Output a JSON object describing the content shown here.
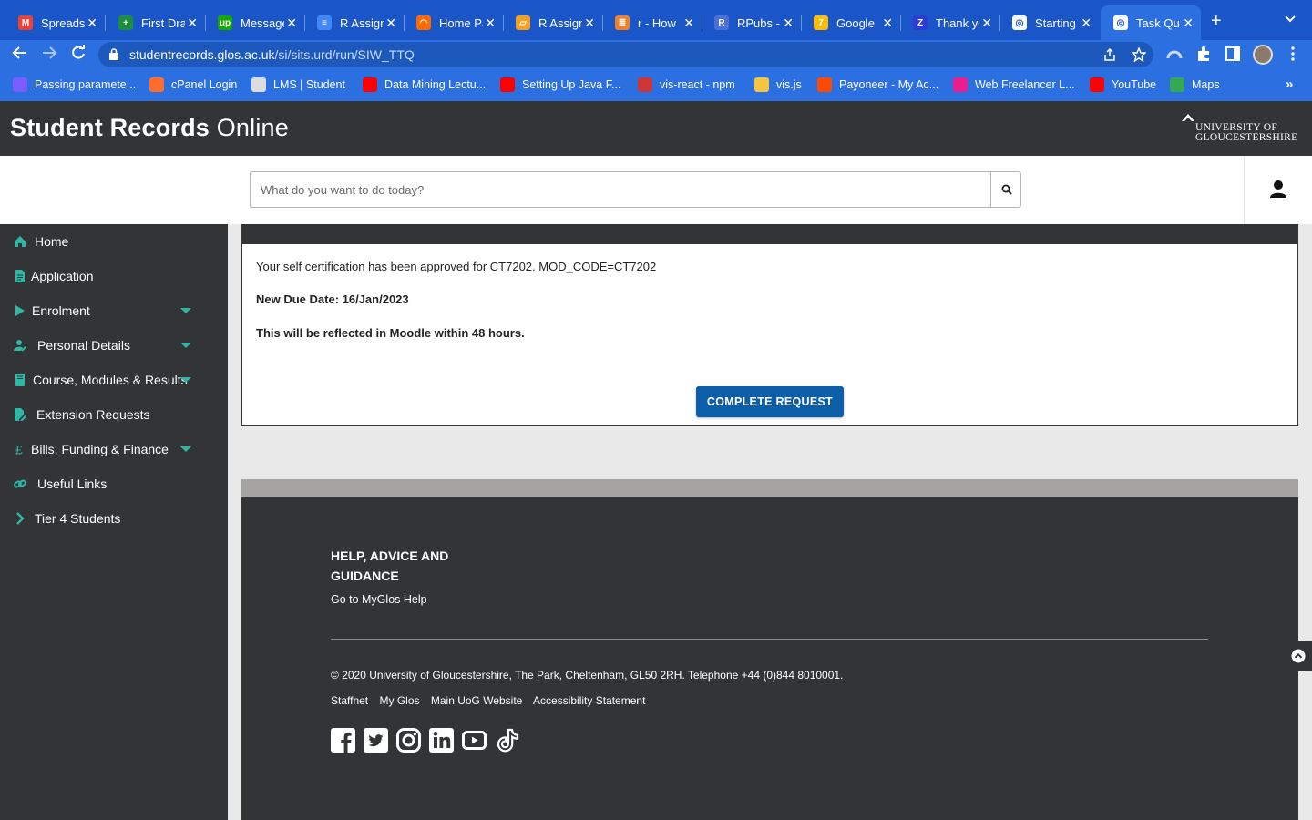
{
  "browser": {
    "tabs": [
      {
        "title": "Spreadsheet",
        "favicon_color": "#ea4335",
        "favicon_glyph": "M"
      },
      {
        "title": "First Draft",
        "favicon_color": "#1e8e3e",
        "favicon_glyph": "+"
      },
      {
        "title": "Messages",
        "favicon_color": "#14a800",
        "favicon_glyph": "up"
      },
      {
        "title": "R Assignment",
        "favicon_color": "#4285f4",
        "favicon_glyph": "≡"
      },
      {
        "title": "Home Page",
        "favicon_color": "#ff6a00",
        "favicon_glyph": "◠"
      },
      {
        "title": "R Assignment",
        "favicon_color": "#f4a020",
        "favicon_glyph": "▱"
      },
      {
        "title": "r - How",
        "favicon_color": "#f48024",
        "favicon_glyph": "≣"
      },
      {
        "title": "RPubs -",
        "favicon_color": "#4a6fd6",
        "favicon_glyph": "R"
      },
      {
        "title": "Google",
        "favicon_color": "#fbbc04",
        "favicon_glyph": "7"
      },
      {
        "title": "Thank you",
        "favicon_color": "#2d3bd7",
        "favicon_glyph": "Z"
      },
      {
        "title": "Starting",
        "favicon_color": "#ffffff",
        "favicon_glyph": "◎"
      },
      {
        "title": "Task Queue",
        "favicon_color": "#ffffff",
        "favicon_glyph": "◎"
      }
    ],
    "url_host": "studentrecords.glos.ac.uk",
    "url_path": "/si/sits.urd/run/SIW_TTQ",
    "bookmarks": [
      {
        "label": "Passing paramete...",
        "color": "#7b5cff"
      },
      {
        "label": "cPanel Login",
        "color": "#ff6c2c"
      },
      {
        "label": "LMS | Student",
        "color": "#dddddd"
      },
      {
        "label": "Data Mining Lectu...",
        "color": "#ff0000"
      },
      {
        "label": "Setting Up Java F...",
        "color": "#ff0000"
      },
      {
        "label": "vis-react - npm",
        "color": "#cb3837"
      },
      {
        "label": "vis.js",
        "color": "#f5c542"
      },
      {
        "label": "Payoneer - My Ac...",
        "color": "#ff4800"
      },
      {
        "label": "Web Freelancer L...",
        "color": "#e91e8c"
      },
      {
        "label": "YouTube",
        "color": "#ff0000"
      },
      {
        "label": "Maps",
        "color": "#34a853"
      }
    ]
  },
  "site": {
    "title_bold": "Student Records",
    "title_light": "Online",
    "logo_line1": "UNIVERSITY OF",
    "logo_line2": "GLOUCESTERSHIRE",
    "search_placeholder": "What do you want to do today?"
  },
  "sidebar": {
    "accent_color": "#2db7a4",
    "items": [
      {
        "label": "Home",
        "icon": "home-icon",
        "has_caret": false
      },
      {
        "label": "Application",
        "icon": "document-icon",
        "has_caret": false
      },
      {
        "label": "Enrolment",
        "icon": "play-icon",
        "has_caret": true
      },
      {
        "label": "Personal Details",
        "icon": "user-edit-icon",
        "has_caret": true
      },
      {
        "label": "Course, Modules & Results",
        "icon": "book-icon",
        "has_caret": true
      },
      {
        "label": "Extension Requests",
        "icon": "file-edit-icon",
        "has_caret": false
      },
      {
        "label": "Bills, Funding & Finance",
        "icon": "pound-icon",
        "has_caret": true
      },
      {
        "label": "Useful Links",
        "icon": "link-icon",
        "has_caret": false
      },
      {
        "label": "Tier 4 Students",
        "icon": "chevron-right-icon",
        "has_caret": false
      }
    ]
  },
  "main": {
    "message_line1": "Your self certification has been approved for CT7202. MOD_CODE=CT7202",
    "message_due": "New Due Date: 16/Jan/2023",
    "message_moodle": "This will be reflected in Moodle within 48 hours.",
    "complete_button": "COMPLETE REQUEST",
    "button_color": "#0c5ea8"
  },
  "footer": {
    "heading": "HELP, ADVICE AND GUIDANCE",
    "help_link": "Go to MyGlos Help",
    "copyright": "© 2020 University of Gloucestershire, The Park, Cheltenham, GL50 2RH. Telephone +44 (0)844 8010001.",
    "links": [
      "Staffnet",
      "My Glos",
      "Main UoG Website",
      "Accessibility Statement"
    ],
    "social": [
      "facebook-icon",
      "twitter-icon",
      "instagram-icon",
      "linkedin-icon",
      "youtube-icon",
      "tiktok-icon"
    ]
  }
}
